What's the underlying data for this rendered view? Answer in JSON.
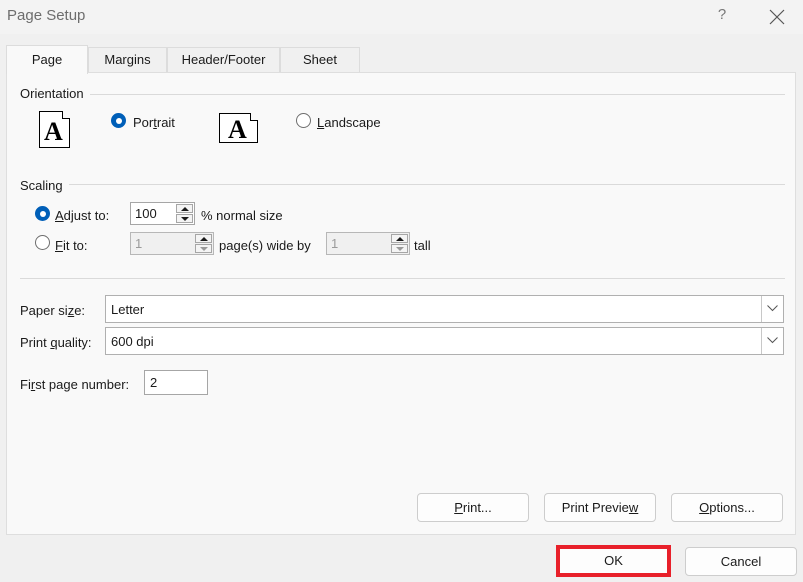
{
  "window": {
    "title": "Page Setup",
    "help_label": "?",
    "close_icon": "close-icon"
  },
  "tabs": [
    {
      "label": "Page",
      "active": true
    },
    {
      "label": "Margins",
      "active": false
    },
    {
      "label": "Header/Footer",
      "active": false
    },
    {
      "label": "Sheet",
      "active": false
    }
  ],
  "orientation": {
    "group_label": "Orientation",
    "portrait": {
      "label_pre": "Por",
      "label_u": "t",
      "label_post": "rait",
      "checked": true,
      "icon_letter": "A"
    },
    "landscape": {
      "label_pre": "",
      "label_u": "L",
      "label_post": "andscape",
      "checked": false,
      "icon_letter": "A"
    }
  },
  "scaling": {
    "group_label": "Scaling",
    "adjust_to": {
      "label_u": "A",
      "label_post": "djust to:",
      "checked": true,
      "value": "100",
      "suffix": "% normal size"
    },
    "fit_to": {
      "label_u": "F",
      "label_post": "it to:",
      "checked": false,
      "wide_value": "1",
      "wide_suffix": "page(s) wide by",
      "tall_value": "1",
      "tall_suffix": "tall"
    }
  },
  "paper": {
    "paper_size": {
      "label_pre": "Paper si",
      "label_u": "z",
      "label_post": "e:",
      "value": "Letter"
    },
    "print_quality": {
      "label_pre": "Print ",
      "label_u": "q",
      "label_post": "uality:",
      "value": "600 dpi"
    },
    "first_page_number": {
      "label_pre": "Fi",
      "label_u": "r",
      "label_post": "st page number:",
      "value": "2"
    }
  },
  "panel_buttons": {
    "print": {
      "label_u": "P",
      "label_post": "rint..."
    },
    "print_preview": {
      "label_pre": "Print Previe",
      "label_u": "w"
    },
    "options": {
      "label_u": "O",
      "label_post": "ptions..."
    }
  },
  "dialog_buttons": {
    "ok": "OK",
    "cancel": "Cancel"
  },
  "colors": {
    "accent": "#005fb8",
    "highlight": "#e8202a"
  }
}
